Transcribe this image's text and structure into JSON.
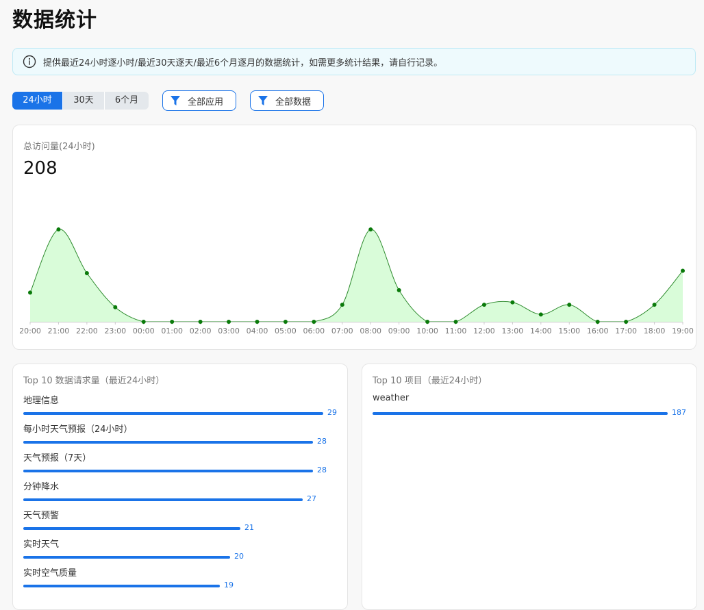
{
  "page": {
    "title": "数据统计"
  },
  "notice": {
    "text": "提供最近24小时逐小时/最近30天逐天/最近6个月逐月的数据统计，如需更多统计结果，请自行记录。",
    "icon": "info-icon"
  },
  "tabs": [
    {
      "label": "24小时",
      "active": true
    },
    {
      "label": "30天",
      "active": false
    },
    {
      "label": "6个月",
      "active": false
    }
  ],
  "filters": {
    "app_label": "全部应用",
    "data_label": "全部数据",
    "icon": "filter-icon"
  },
  "colors": {
    "accent": "#1a73e8",
    "chart_fill": "#d9fcd9",
    "chart_line": "#2e8b2e",
    "chart_point": "#0a7a0a"
  },
  "overview": {
    "title": "总访问量(24小时)",
    "total": "208"
  },
  "chart_data": {
    "type": "area",
    "title": "总访问量(24小时)",
    "x": [
      "20:00",
      "21:00",
      "22:00",
      "23:00",
      "00:00",
      "01:00",
      "02:00",
      "03:00",
      "04:00",
      "05:00",
      "06:00",
      "07:00",
      "08:00",
      "09:00",
      "10:00",
      "11:00",
      "12:00",
      "13:00",
      "14:00",
      "15:00",
      "16:00",
      "17:00",
      "18:00",
      "19:00"
    ],
    "values": [
      12,
      38,
      20,
      6,
      0,
      0,
      0,
      0,
      0,
      0,
      0,
      7,
      38,
      13,
      0,
      0,
      7,
      8,
      3,
      7,
      0,
      0,
      7,
      21
    ],
    "ylim": [
      0,
      40
    ],
    "grid": false,
    "legend": "none"
  },
  "top_requests": {
    "title": "Top 10 数据请求量（最近24小时）",
    "max": 29,
    "items": [
      {
        "label": "地理信息",
        "value": 29
      },
      {
        "label": "每小时天气预报（24小时）",
        "value": 28
      },
      {
        "label": "天气预报（7天）",
        "value": 28
      },
      {
        "label": "分钟降水",
        "value": 27
      },
      {
        "label": "天气预警",
        "value": 21
      },
      {
        "label": "实时天气",
        "value": 20
      },
      {
        "label": "实时空气质量",
        "value": 19
      }
    ]
  },
  "top_projects": {
    "title": "Top 10 项目（最近24小时）",
    "max": 187,
    "items": [
      {
        "label": "weather",
        "value": 187
      }
    ]
  }
}
